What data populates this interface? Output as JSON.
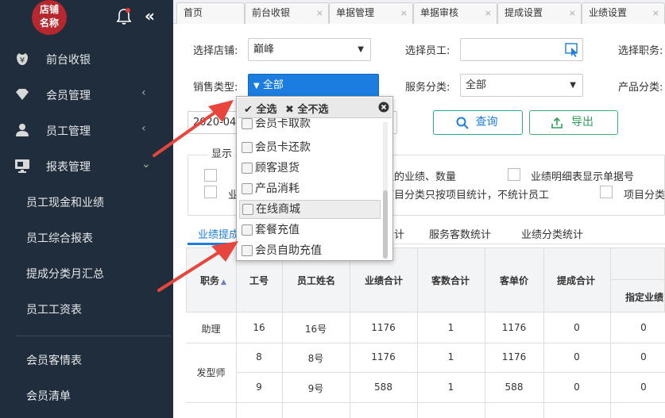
{
  "sidebar": {
    "logo_line1": "店铺",
    "logo_line2": "名称",
    "collapse_glyph": "«",
    "menu": [
      {
        "label": "前台收银",
        "icon": "yen-icon",
        "arrow": ""
      },
      {
        "label": "会员管理",
        "icon": "diamond-icon",
        "arrow": "‹"
      },
      {
        "label": "员工管理",
        "icon": "user-icon",
        "arrow": "‹"
      },
      {
        "label": "报表管理",
        "icon": "monitor-icon",
        "arrow": "⌄"
      }
    ],
    "sub_items": [
      "员工现金和业绩",
      "员工综合报表",
      "提成分类月汇总",
      "员工工资表",
      "会员客情表",
      "会员清单"
    ]
  },
  "tabs": [
    {
      "label": "首页",
      "close": ""
    },
    {
      "label": "前台收银",
      "close": "×"
    },
    {
      "label": "单据管理",
      "close": "×"
    },
    {
      "label": "单据审核",
      "close": "×"
    },
    {
      "label": "提成设置",
      "close": "×"
    },
    {
      "label": "业绩设置",
      "close": "×"
    }
  ],
  "filters": {
    "store_label": "选择店铺:",
    "store_value": "巅峰",
    "employee_label": "选择员工:",
    "employee_value": "",
    "position_label": "选择职务:",
    "sales_type_label": "销售类型:",
    "sales_type_value": "全部",
    "service_class_label": "服务分类:",
    "service_class_value": "全部",
    "product_class_label": "产品分类:",
    "date_value": "2020-04",
    "query_button": "查询",
    "export_button": "导出"
  },
  "options": {
    "legend": "显示",
    "opt1": "值的业绩、数量",
    "opt2": "业绩明细表显示单据号",
    "opt3": "项目分类只按项目统计，不统计员工",
    "opt4": "项目分类",
    "opt5_prefix": "业"
  },
  "subtabs": [
    "业绩提成",
    "计",
    "服务客数统计",
    "业绩分类统计"
  ],
  "dropdown": {
    "select_all": "全选",
    "select_none": "全不选",
    "items": [
      "会员卡取款",
      "会员卡还款",
      "顾客退货",
      "产品消耗",
      "在线商城",
      "套餐充值",
      "会员自助充值"
    ],
    "highlighted": "在线商城"
  },
  "table": {
    "headers": [
      "职务",
      "工号",
      "员工姓名",
      "业绩合计",
      "客数合计",
      "客单价",
      "提成合计"
    ],
    "sub_header": "指定业绩",
    "sort_glyph": "▲",
    "rows": [
      {
        "role": "助理",
        "id": "16",
        "name": "16号",
        "perf": "1176",
        "count": "1",
        "avg": "1176",
        "comm": "0",
        "spec": "0"
      },
      {
        "role": "发型师",
        "id": "8",
        "name": "8号",
        "perf": "1176",
        "count": "1",
        "avg": "1176",
        "comm": "0",
        "spec": "0"
      },
      {
        "role": "",
        "id": "9",
        "name": "9号",
        "perf": "588",
        "count": "1",
        "avg": "588",
        "comm": "0",
        "spec": "0"
      }
    ]
  },
  "colors": {
    "sidebar": "#1f2d3d",
    "accent": "#1a7ddf",
    "annotation": "#e8453c"
  }
}
